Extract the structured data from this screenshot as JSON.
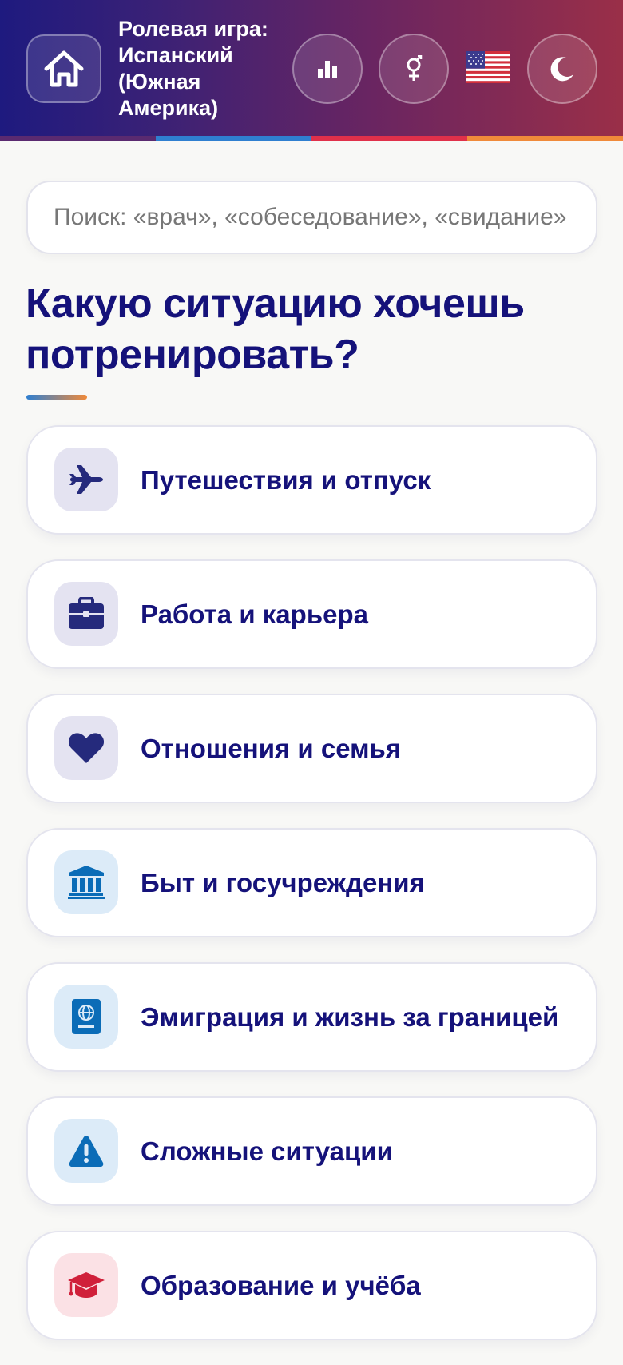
{
  "header": {
    "title": "Ролевая игра: Испанский (Южная Америка)",
    "home_icon": "home-icon",
    "stats_icon": "bar-chart-icon",
    "gender_icon": "gender-icon",
    "flag_icon": "us-flag-icon",
    "theme_icon": "moon-icon"
  },
  "search": {
    "placeholder": "Поиск: «врач», «собеседование», «свидание»",
    "value": ""
  },
  "main": {
    "heading": "Какую ситуацию хочешь потренировать?",
    "categories": [
      {
        "label": "Путешествия и отпуск",
        "icon": "plane-icon",
        "color": "#e4e3f1"
      },
      {
        "label": "Работа и карьера",
        "icon": "briefcase-icon",
        "color": "#e4e3f1"
      },
      {
        "label": "Отношения и семья",
        "icon": "heart-icon",
        "color": "#e4e3f1"
      },
      {
        "label": "Быт и госучреждения",
        "icon": "bank-icon",
        "color": "#dcebf8"
      },
      {
        "label": "Эмиграция и жизнь за границей",
        "icon": "passport-icon",
        "color": "#dcebf8"
      },
      {
        "label": "Сложные ситуации",
        "icon": "warning-icon",
        "color": "#dcebf8"
      },
      {
        "label": "Образование и учёба",
        "icon": "graduation-cap-icon",
        "color": "#fbe1e5"
      }
    ]
  },
  "colors": {
    "primary_text": "#15127a",
    "header_gradient_start": "#1e1a7f",
    "header_gradient_end": "#9a2f48",
    "accent_blue": "#2f7fd0",
    "accent_red": "#e0304a",
    "accent_orange": "#f08a3a"
  }
}
